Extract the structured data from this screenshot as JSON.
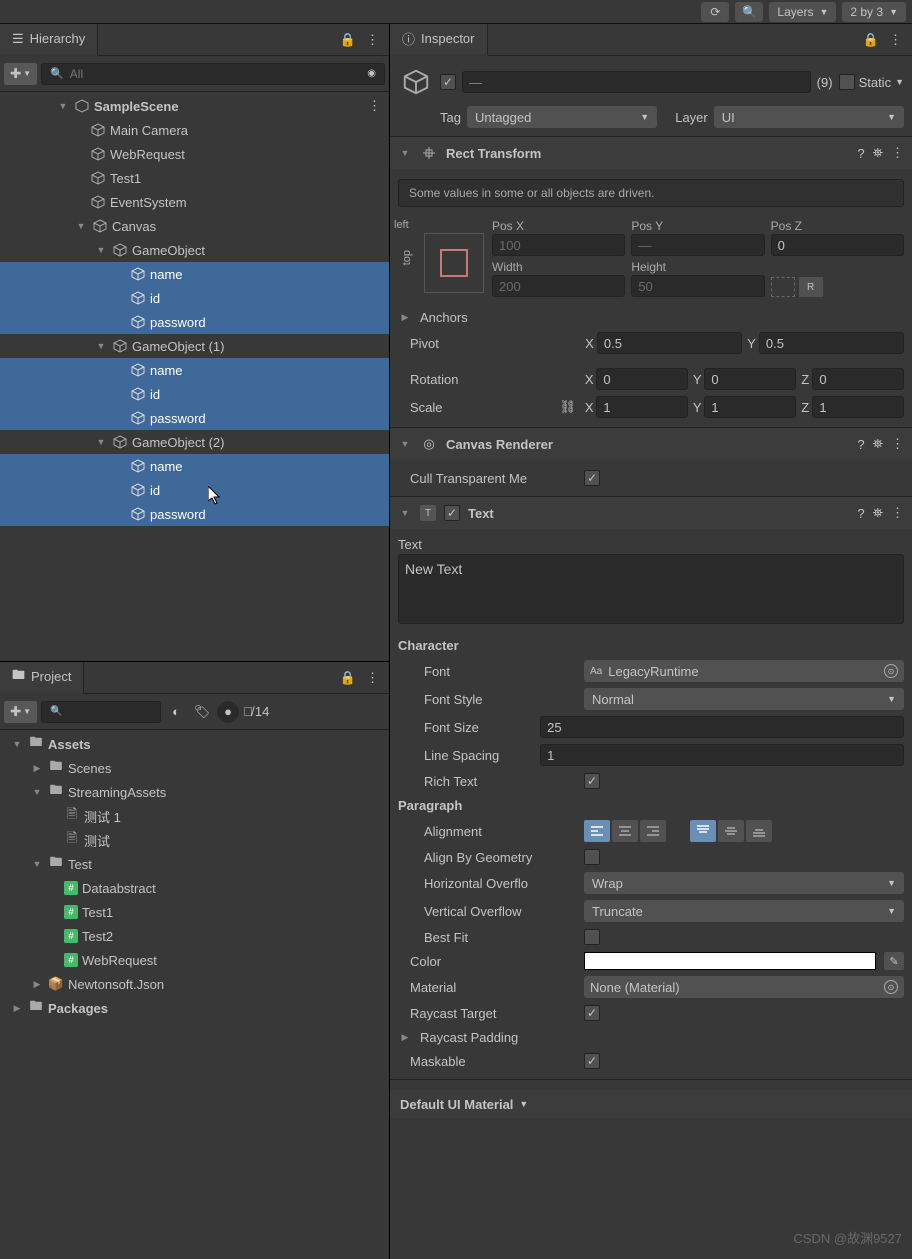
{
  "topbar": {
    "layers_label": "Layers",
    "layout_label": "2 by 3"
  },
  "hierarchy": {
    "title": "Hierarchy",
    "search_placeholder": "All",
    "scene": "SampleScene",
    "items": [
      "Main Camera",
      "WebRequest",
      "Test1",
      "EventSystem",
      "Canvas"
    ],
    "game_objects": [
      "GameObject",
      "GameObject (1)",
      "GameObject (2)"
    ],
    "children": [
      "name",
      "id",
      "password"
    ]
  },
  "project": {
    "title": "Project",
    "hidden_count": "14",
    "assets": "Assets",
    "scenes": "Scenes",
    "streaming": "StreamingAssets",
    "s_items": [
      "测试 1",
      "测试"
    ],
    "test_folder": "Test",
    "test_items": [
      "Dataabstract",
      "Test1",
      "Test2",
      "WebRequest"
    ],
    "newtonsoft": "Newtonsoft.Json",
    "packages": "Packages"
  },
  "inspector": {
    "title": "Inspector",
    "name_placeholder": "—",
    "count": "(9)",
    "static_label": "Static",
    "tag_label": "Tag",
    "tag_value": "Untagged",
    "layer_label": "Layer",
    "layer_value": "UI",
    "rect": {
      "title": "Rect Transform",
      "driven": "Some values in some or all objects are driven.",
      "anchor_left": "left",
      "anchor_top": "top",
      "pos_x_l": "Pos X",
      "pos_x": "100",
      "pos_y_l": "Pos Y",
      "pos_y": "—",
      "pos_z_l": "Pos Z",
      "pos_z": "0",
      "width_l": "Width",
      "width": "200",
      "height_l": "Height",
      "height": "50",
      "anchors_l": "Anchors",
      "pivot_l": "Pivot",
      "pivot_x": "0.5",
      "pivot_y": "0.5",
      "rotation_l": "Rotation",
      "rot_x": "0",
      "rot_y": "0",
      "rot_z": "0",
      "scale_l": "Scale",
      "sc_x": "1",
      "sc_y": "1",
      "sc_z": "1"
    },
    "canvas_renderer": {
      "title": "Canvas Renderer",
      "cull_l": "Cull Transparent Me"
    },
    "text": {
      "title": "Text",
      "text_l": "Text",
      "value": "New Text",
      "character_l": "Character",
      "font_l": "Font",
      "font_v": "LegacyRuntime",
      "font_style_l": "Font Style",
      "font_style_v": "Normal",
      "font_size_l": "Font Size",
      "font_size_v": "25",
      "line_spacing_l": "Line Spacing",
      "line_spacing_v": "1",
      "rich_text_l": "Rich Text",
      "paragraph_l": "Paragraph",
      "alignment_l": "Alignment",
      "align_geom_l": "Align By Geometry",
      "h_overflow_l": "Horizontal Overflo",
      "h_overflow_v": "Wrap",
      "v_overflow_l": "Vertical Overflow",
      "v_overflow_v": "Truncate",
      "best_fit_l": "Best Fit",
      "color_l": "Color",
      "material_l": "Material",
      "material_v": "None (Material)",
      "raycast_l": "Raycast Target",
      "raycast_pad_l": "Raycast Padding",
      "maskable_l": "Maskable"
    },
    "default_material": "Default UI Material"
  },
  "watermark": "CSDN @故渊9527"
}
